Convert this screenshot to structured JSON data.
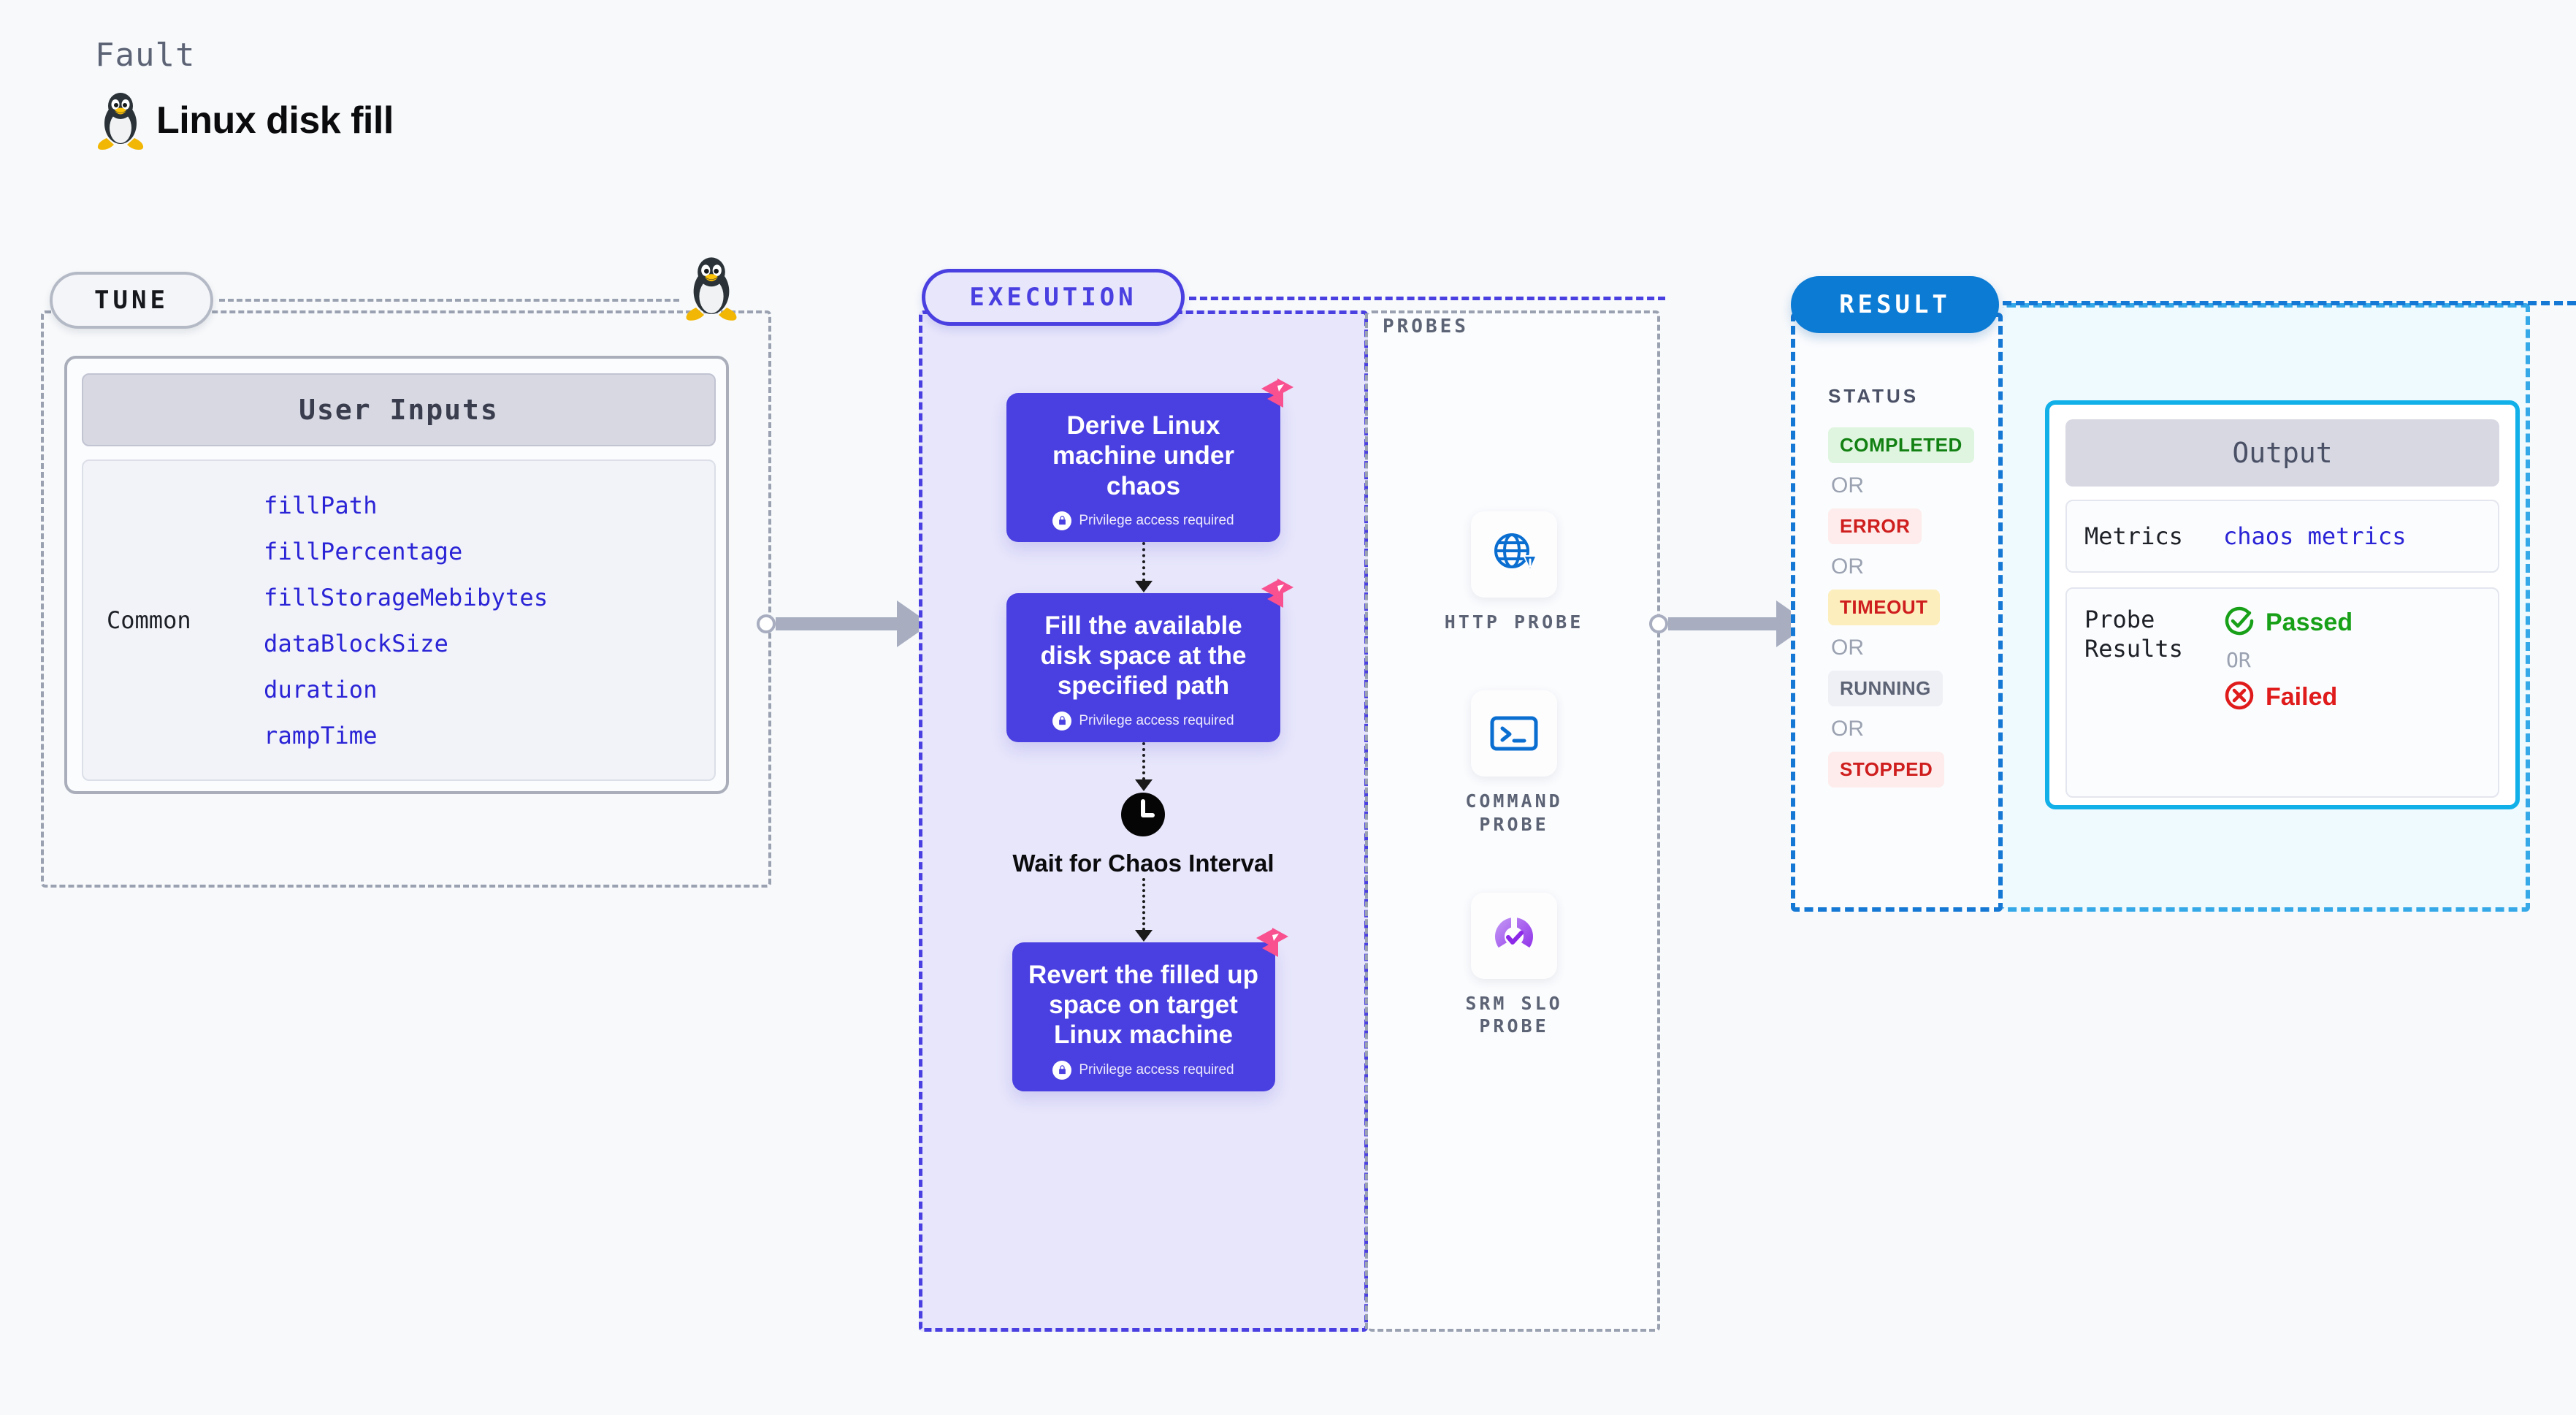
{
  "header": {
    "kicker": "Fault",
    "title": "Linux disk fill",
    "icon": "linux-penguin-icon"
  },
  "tune": {
    "badge": "TUNE",
    "icon": "linux-penguin-icon",
    "card": {
      "header": "User Inputs",
      "group_label": "Common",
      "inputs": [
        "fillPath",
        "fillPercentage",
        "fillStorageMebibytes",
        "dataBlockSize",
        "duration",
        "rampTime"
      ]
    }
  },
  "execution": {
    "badge": "EXECUTION",
    "privilege_note": "Privilege access required",
    "steps": [
      {
        "kind": "task",
        "title": "Derive Linux machine under chaos",
        "privileged": true
      },
      {
        "kind": "task",
        "title": "Fill the available disk space at the specified path",
        "privileged": true
      },
      {
        "kind": "wait",
        "title": "Wait for Chaos Interval",
        "icon": "clock-icon"
      },
      {
        "kind": "task",
        "title": "Revert the filled up space on target Linux machine",
        "privileged": true
      }
    ]
  },
  "probes": {
    "title": "PROBES",
    "items": [
      {
        "label": "HTTP PROBE",
        "icon": "globe-warning-icon"
      },
      {
        "label": "COMMAND PROBE",
        "icon": "terminal-icon"
      },
      {
        "label": "SRM SLO PROBE",
        "icon": "slo-gauge-icon"
      }
    ]
  },
  "result": {
    "badge": "RESULT",
    "status_title": "STATUS",
    "or_label": "OR",
    "statuses": [
      {
        "label": "COMPLETED",
        "bg": "#dff5df",
        "fg": "#128012"
      },
      {
        "label": "ERROR",
        "bg": "#fdeceb",
        "fg": "#cf1e1e"
      },
      {
        "label": "TIMEOUT",
        "bg": "#fdeebd",
        "fg": "#cf1e1e"
      },
      {
        "label": "RUNNING",
        "bg": "#eff0f5",
        "fg": "#5c6375"
      },
      {
        "label": "STOPPED",
        "bg": "#fdeceb",
        "fg": "#cf1e1e"
      }
    ]
  },
  "output": {
    "header": "Output",
    "metrics_label": "Metrics",
    "metrics_value": "chaos metrics",
    "probe_results_label": "Probe Results",
    "passed_label": "Passed",
    "failed_label": "Failed",
    "or_label": "OR"
  },
  "colors": {
    "purple": "#4a3fe0",
    "purple_tint": "#e7e6fb",
    "result_blue": "#0b7bd4",
    "output_cyan": "#12b0e8",
    "output_tint": "#effafe",
    "grey_dash": "#9aa1b0",
    "chaos_pink": "#f9508f",
    "code_blue": "#2b24d6"
  }
}
